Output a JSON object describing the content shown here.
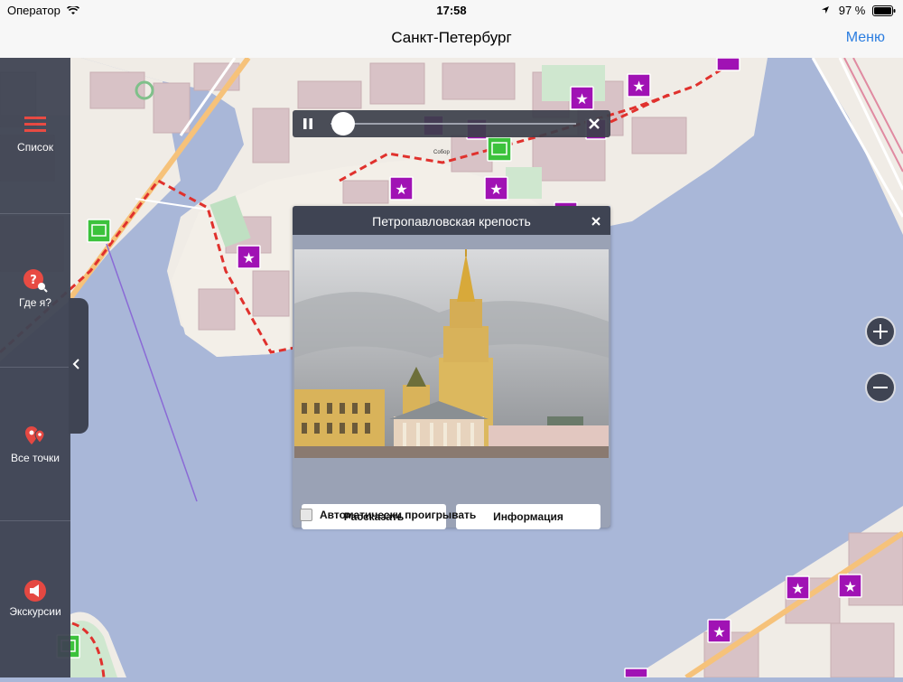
{
  "status_bar": {
    "carrier": "Оператор",
    "time": "17:58",
    "battery": "97 %"
  },
  "nav": {
    "title": "Санкт-Петербург",
    "menu_label": "Меню"
  },
  "sidebar": {
    "items": [
      {
        "label": "Список",
        "icon": "list-icon"
      },
      {
        "label": "Где я?",
        "icon": "where-am-i-icon"
      },
      {
        "label": "Все точки",
        "icon": "all-points-icon"
      },
      {
        "label": "Экскурсии",
        "icon": "excursion-icon"
      }
    ],
    "collapse_icon": "chevron-left-icon"
  },
  "audio_player": {
    "progress": 0.05,
    "play_state": "paused"
  },
  "popup": {
    "title": "Петропавловская крепость",
    "tell_button": "Рассказать",
    "info_button": "Информация",
    "autoplay_label": "Автоматически проигрывать",
    "autoplay_checked": false
  },
  "map": {
    "labels": {
      "sobor": "Собор"
    },
    "colors": {
      "water": "#a9b7d8",
      "land": "#f0ece6",
      "building": "#d8c2c6",
      "route": "#e0312d",
      "poi": "#a012b4",
      "poi_selected": "#3cc23c"
    }
  }
}
